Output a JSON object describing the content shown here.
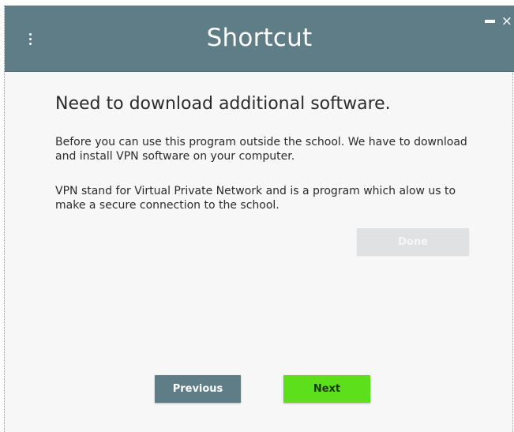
{
  "window": {
    "title": "Shortcut",
    "close_glyph": "×"
  },
  "content": {
    "heading": "Need to download additional software.",
    "paragraph_1": "Before you can use this program outside the school. We have to download and install VPN software on your computer.",
    "paragraph_2": "VPN stand for Virtual Private Network and is a program which alow us to make a secure connection to the school.",
    "done_label": "Done"
  },
  "navigation": {
    "previous_label": "Previous",
    "next_label": "Next"
  },
  "colors": {
    "titlebar": "#5f7d87",
    "previous_button": "#5f7d87",
    "next_button": "#5de01b",
    "done_button_disabled": "#dfe1e2"
  },
  "icons": {
    "menu": "more-vertical-icon",
    "minimize": "minimize-icon",
    "close": "close-icon"
  }
}
